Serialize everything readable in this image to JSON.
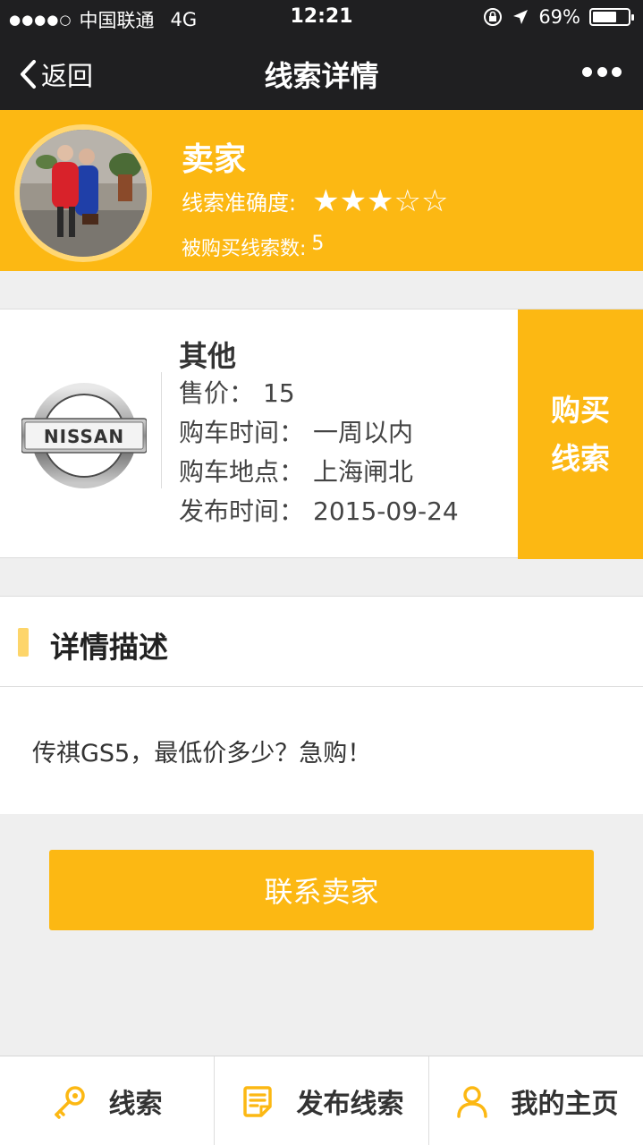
{
  "status_bar": {
    "carrier": "中国联通",
    "network": "4G",
    "time": "12:21",
    "battery": "69%",
    "battery_level": 0.69
  },
  "nav": {
    "back_label": "返回",
    "title": "线索详情"
  },
  "seller": {
    "name": "卖家",
    "accuracy_label": "线索准确度:",
    "rating": 3,
    "rating_max": 5,
    "stars_text": "★★★☆☆",
    "purchased_label": "被购买线索数:",
    "purchased_count": "5"
  },
  "lead": {
    "brand": "其他",
    "logo_text": "NISSAN",
    "rows": [
      {
        "label": "售价：",
        "value": "15"
      },
      {
        "label": "购车时间：",
        "value": "一周以内"
      },
      {
        "label": "购车地点：",
        "value": "上海闸北"
      },
      {
        "label": "发布时间：",
        "value": "2015-09-24"
      }
    ],
    "buy_line1": "购买",
    "buy_line2": "线索"
  },
  "detail": {
    "title": "详情描述",
    "text": "传祺GS5，最低价多少？急购！"
  },
  "contact_button": "联系卖家",
  "tabs": [
    {
      "label": "线索",
      "icon": "key-icon"
    },
    {
      "label": "发布线索",
      "icon": "document-edit-icon"
    },
    {
      "label": "我的主页",
      "icon": "user-icon"
    }
  ],
  "colors": {
    "accent": "#fcb813",
    "dark_bar": "#1f1f21"
  }
}
